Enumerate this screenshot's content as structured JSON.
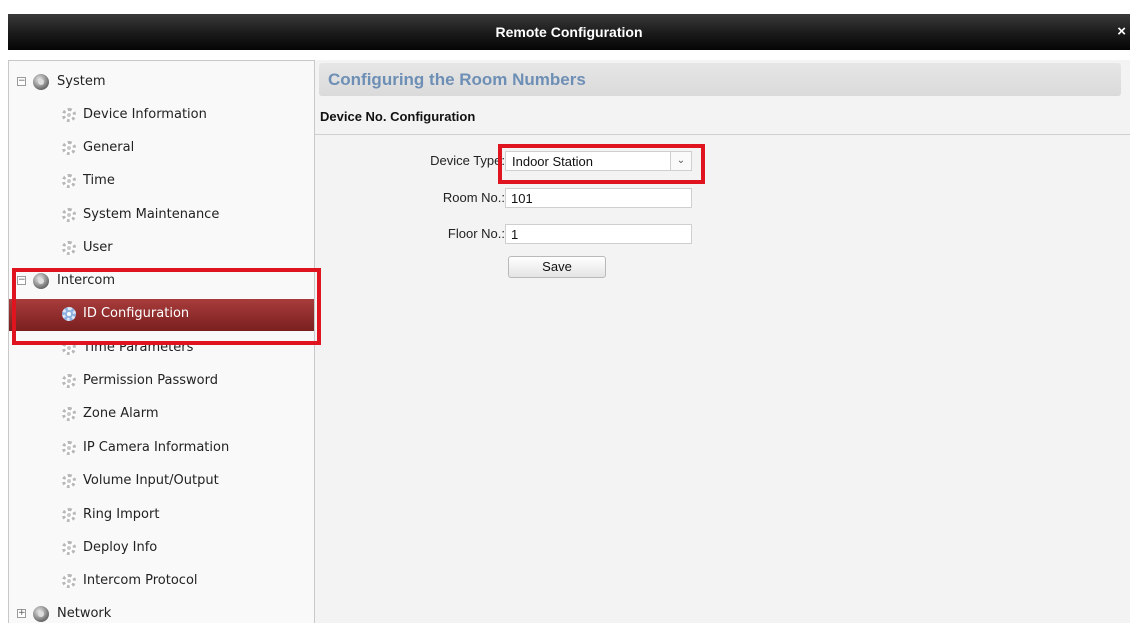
{
  "window": {
    "title": "Remote Configuration",
    "close_glyph": "×"
  },
  "sidebar": {
    "groups": [
      {
        "label": "System",
        "expander": "−",
        "icon": "settings-gear-icon",
        "items": [
          {
            "label": "Device Information"
          },
          {
            "label": "General"
          },
          {
            "label": "Time"
          },
          {
            "label": "System Maintenance"
          },
          {
            "label": "User"
          }
        ]
      },
      {
        "label": "Intercom",
        "expander": "−",
        "icon": "settings-gear-icon",
        "items": [
          {
            "label": "ID Configuration",
            "selected": true
          },
          {
            "label": "Time Parameters"
          },
          {
            "label": "Permission Password"
          },
          {
            "label": "Zone Alarm"
          },
          {
            "label": "IP Camera Information"
          },
          {
            "label": "Volume Input/Output"
          },
          {
            "label": "Ring Import"
          },
          {
            "label": "Deploy Info"
          },
          {
            "label": "Intercom Protocol"
          }
        ]
      },
      {
        "label": "Network",
        "expander": "+",
        "icon": "settings-gear-icon",
        "items": []
      }
    ]
  },
  "main": {
    "section_title": "Configuring the Room Numbers",
    "subheading": "Device No. Configuration",
    "form": {
      "device_type_label": "Device Type:",
      "device_type_value": "Indoor Station",
      "room_no_label": "Room No.:",
      "room_no_value": "101",
      "floor_no_label": "Floor No.:",
      "floor_no_value": "1",
      "save_label": "Save"
    }
  },
  "colors": {
    "highlight_box": "#e0141e",
    "selected_item": "#8b2a2a",
    "section_title": "#6e8fb5"
  }
}
